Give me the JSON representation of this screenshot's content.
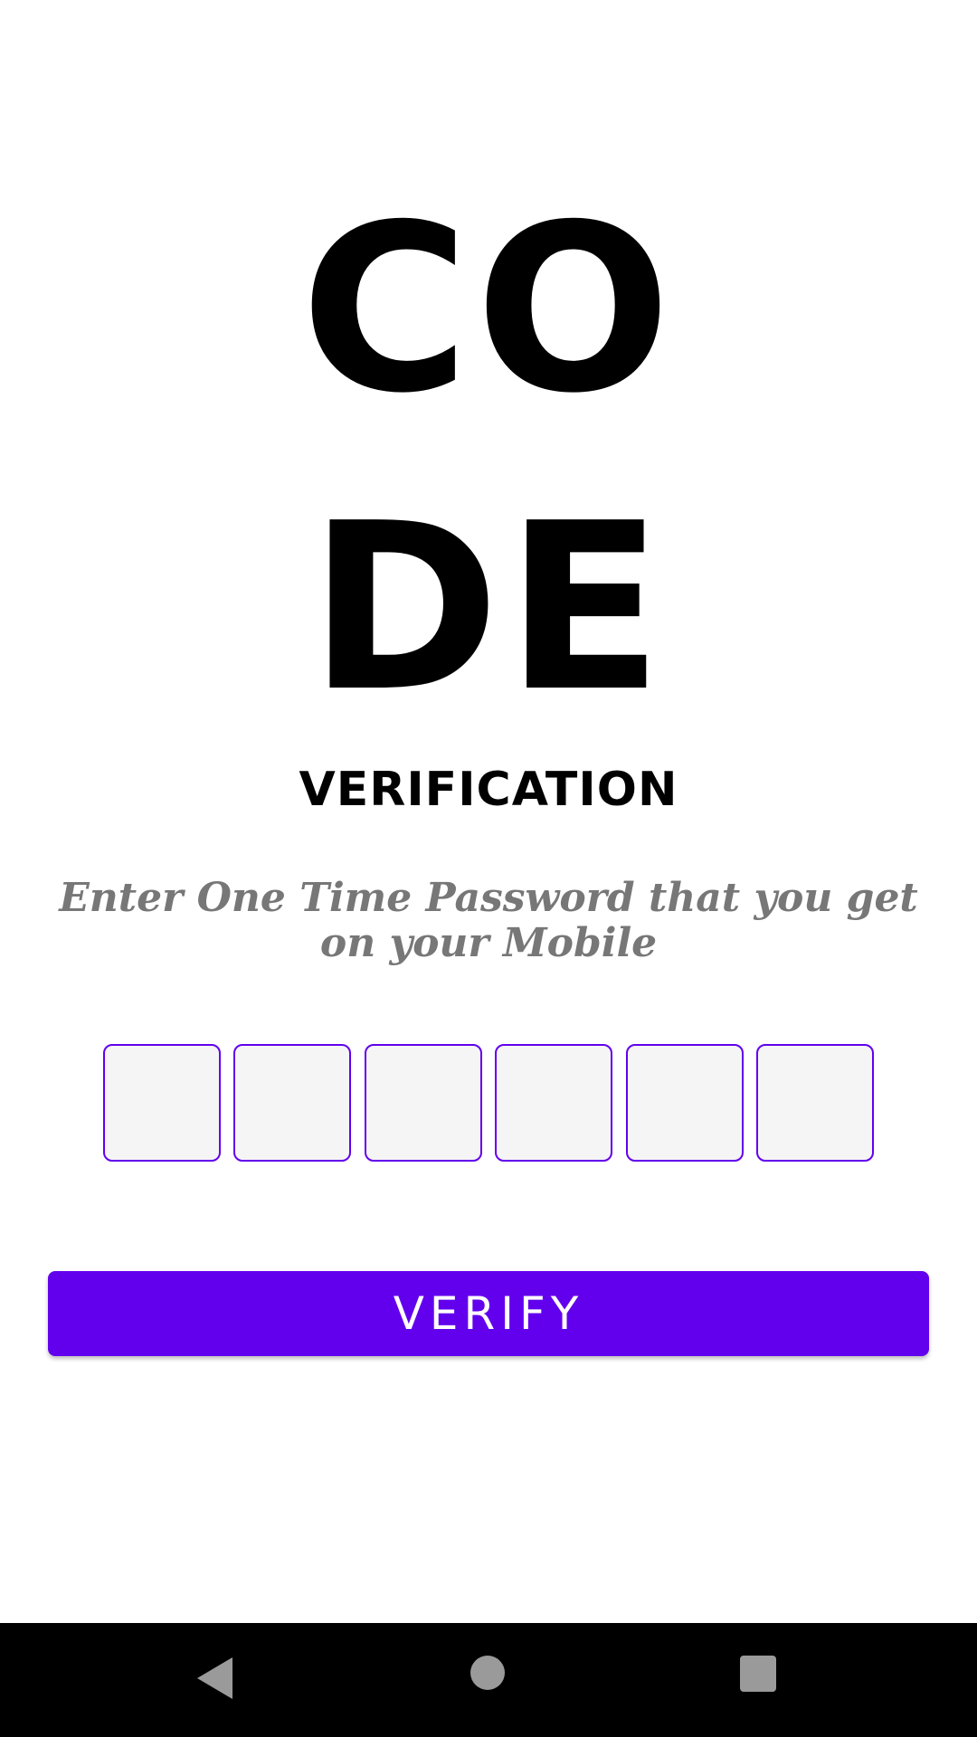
{
  "header": {
    "title_line_1": "CO",
    "title_line_2": "DE",
    "subtitle": "VERIFICATION"
  },
  "instructions": "Enter One Time Password that you get on your Mobile",
  "otp": {
    "digits": [
      "",
      "",
      "",
      "",
      "",
      ""
    ]
  },
  "verify_button": {
    "label": "VERIFY"
  },
  "colors": {
    "accent": "#6200ee",
    "otp_box_fill": "#f5f5f5",
    "instruction_text": "#777777"
  },
  "nav_bar": {
    "back_icon": "back-triangle-icon",
    "home_icon": "home-circle-icon",
    "recents_icon": "recents-square-icon"
  }
}
